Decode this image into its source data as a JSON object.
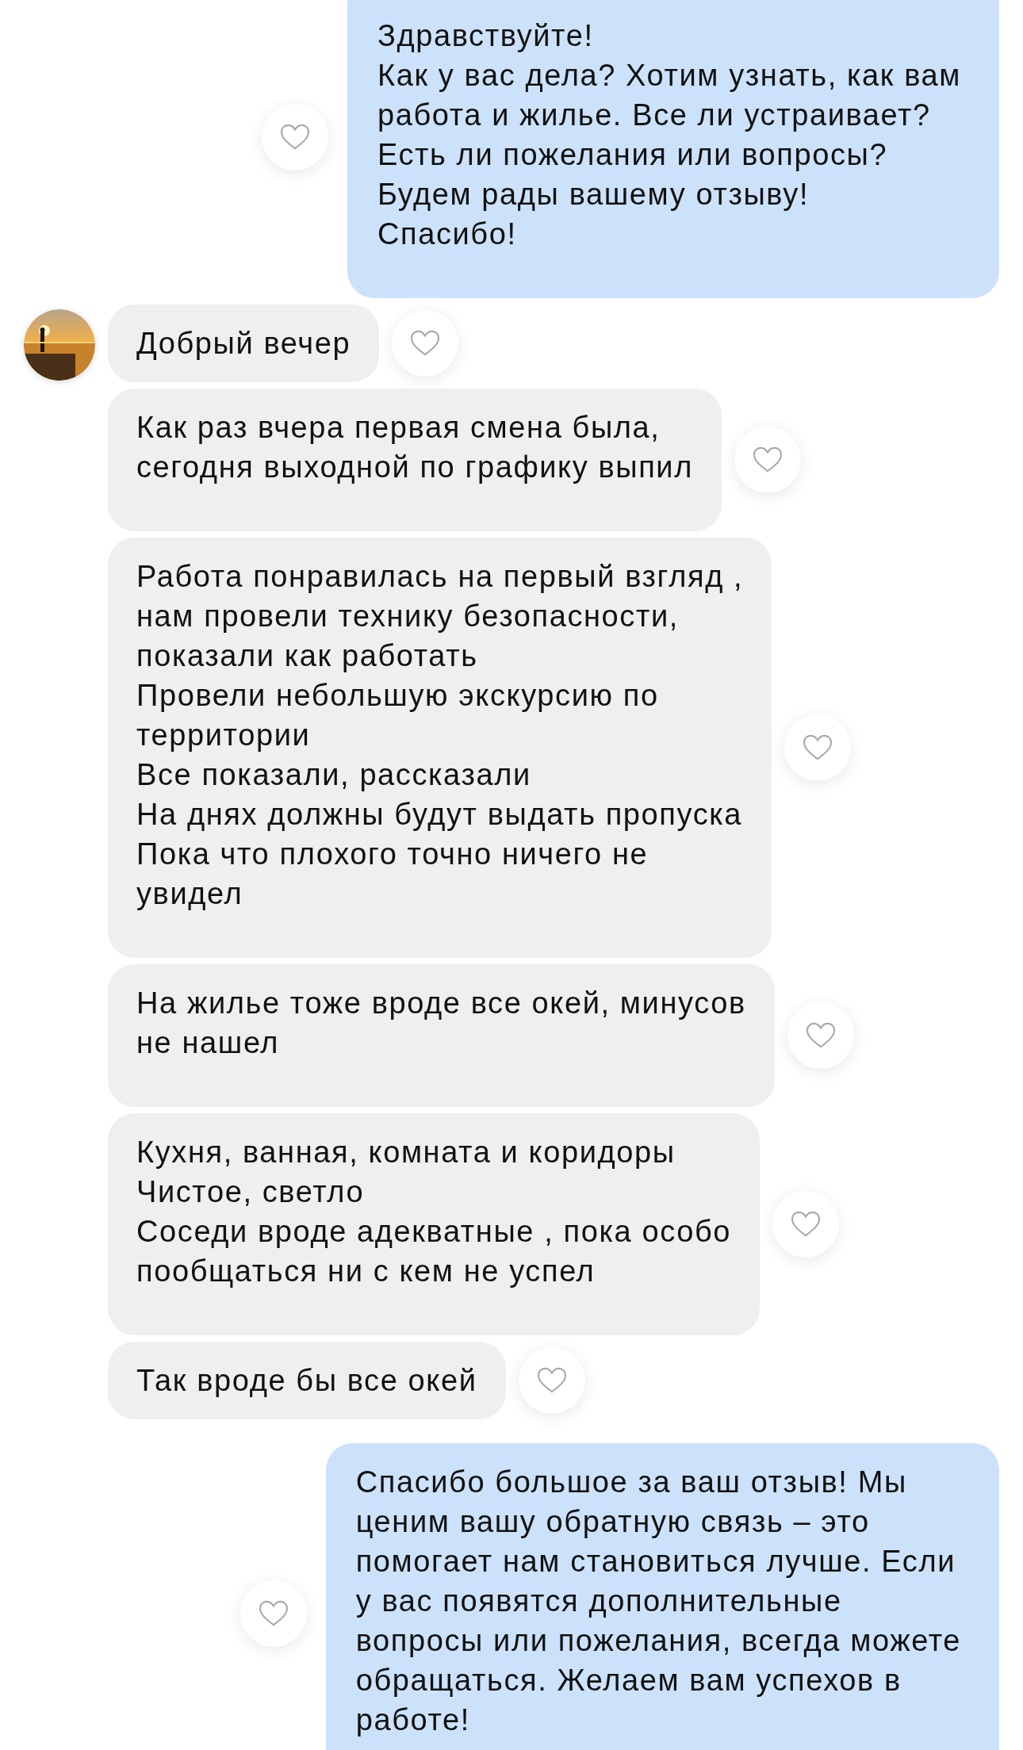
{
  "messages": [
    {
      "kind": "outgoing",
      "text": "Здравствуйте!\nКак у вас дела? Хотим узнать, как вам\nработа и жилье. Все ли устраивает?\nЕсть ли пожелания или вопросы?\nБудем рады вашему отзыву!\nСпасибо!"
    },
    {
      "kind": "incoming",
      "avatar": true,
      "text": "Добрый вечер"
    },
    {
      "kind": "incoming",
      "avatar": false,
      "text": "Как раз вчера первая смена была,\nсегодня выходной по графику выпил"
    },
    {
      "kind": "incoming",
      "avatar": false,
      "text": "Работа понравилась на первый взгляд ,\nнам провели технику безопасности,\nпоказали как работать\nПровели небольшую экскурсию по\nтерритории\nВсе показали, рассказали\nНа днях должны будут выдать пропуска\nПока что плохого точно ничего не\nувидел"
    },
    {
      "kind": "incoming",
      "avatar": false,
      "text": "На жилье тоже вроде все окей, минусов\nне нашел"
    },
    {
      "kind": "incoming",
      "avatar": false,
      "text": "Кухня, ванная, комната и коридоры\nЧистое, светло\nСоседи вроде адекватные , пока особо\nпообщаться ни с кем не успел"
    },
    {
      "kind": "incoming",
      "avatar": false,
      "text": "Так вроде бы все окей"
    },
    {
      "kind": "outgoing",
      "text": "Спасибо большое за ваш отзыв! Мы\nценим вашу обратную связь – это\nпомогает нам становиться лучше. Если\nу вас появятся дополнительные\nвопросы или пожелания, всегда можете\nобращаться. Желаем вам успехов в\nработе!"
    }
  ]
}
